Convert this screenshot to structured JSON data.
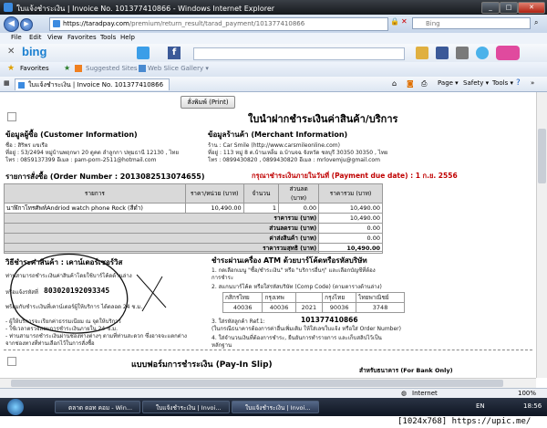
{
  "window": {
    "title": "ใบแจ้งชำระเงิน | Invoice No. 101377410866 - Windows Internet Explorer"
  },
  "address": {
    "url_prefix": "https://taradpay.com",
    "url_rest": "/premium/return_result/tarad_payment/101377410866",
    "search_placeholder": "Bing"
  },
  "menu": [
    "File",
    "Edit",
    "View",
    "Favorites",
    "Tools",
    "Help"
  ],
  "toolbar": {
    "bing": "bing"
  },
  "favorites": {
    "label": "Favorites",
    "suggested": "Suggested Sites ▾",
    "gallery": "Web Slice Gallery ▾"
  },
  "tab": {
    "label": "ใบแจ้งชำระเงิน | Invoice No. 101377410866",
    "cmds": [
      "Page ▾",
      "Safety ▾",
      "Tools ▾"
    ]
  },
  "invoice": {
    "print_button": "สั่งพิมพ์ (Print)",
    "title": "ใบนำฝากชำระเงินค่าสินค้า/บริการ",
    "customer_heading": "ข้อมูลผู้ซื้อ (Customer Information)",
    "customer_lines": [
      "ชื่อ : สิริพร แขเรือ",
      "ที่อยู่ : 53/2494 หมู่บ้านพฤกษา 20 ตูคต ลำลูกกา ปทุมธานี 12130 , ไทย",
      "โทร : 0859137399 อีเมล : pam-porn-2511@hotmail.com"
    ],
    "merchant_heading": "ข้อมูลร้านค้า (Merchant Information)",
    "merchant_lines": [
      "ร้าน : Car Smile (http://www.carsmileonline.com)",
      "ที่อยู่ : 113 หมู่ 8 ต.บ้านเหล็ม อ.บ้านจฉ  จังหวัด ชลบุรี 30350 30350 , ไทย",
      "โทร : 0899430820 , 0899430820 อีเมล : mrlovemju@gmail.com"
    ],
    "order_heading": "รายการสั่งซื้อ (Order Number : 2013082513074655)",
    "due_date": "กรุณาชำระเงินภายในวันที่ (Payment due date) : 1 ก.ย. 2556",
    "columns": [
      "รายการ",
      "ราคา/หน่วย (บาท)",
      "จำนวน",
      "ส่วนลด (บาท)",
      "ราคารวม (บาท)"
    ],
    "items": [
      {
        "name": "นาฬิกาโทรศัพท์Andriod watch phone Rock (สีดำ)",
        "price": "10,490.00",
        "qty": "1",
        "discount": "0.00",
        "total": "10,490.00"
      }
    ],
    "totals": [
      {
        "label": "ราคารวม (บาท)",
        "value": "10,490.00"
      },
      {
        "label": "ส่วนลดรวม (บาท)",
        "value": "0.00"
      },
      {
        "label": "ค่าส่งสินค้า (บาท)",
        "value": "0.00"
      },
      {
        "label": "ราคารวมสุทธิ (บาท)",
        "value": "10,490.00"
      }
    ],
    "counter_heading": "วิธีชำระค่าสินค้า : เคาน์เตอร์เซอร์วิส",
    "counter_line1": "ท่านสามารถชำระเงินค่าสินค้าโดยใช้บาร์โค้ดด้านล่าง",
    "ref_label": "หรือแจ้งรหัสที่",
    "ref_code": "803020192093345",
    "counter_line2": "พร้อมกับชำระเงินที่เคาน์เตอร์ผู้ให้บริการ ได้ตลอด 24 ช.ม.",
    "counter_notes": [
      "- ผู้ให้บริการจะเรียกค่าธรรมเนียม ณ จุดให้บริการ",
      "- ใช้เวลาตรวจสอบการชำระเงินภายใน 24 ช.ม.",
      "- ท่านสามารถชำระเงินผ่านช่องทางต่างๆ ตามที่ท่านสะดวก ซึ่งอาจจะแตกต่าง",
      "  จากช่องทางที่ท่านเลือกไว้ในการสั่งซื้อ"
    ],
    "atm_heading": "ชำระผ่านเครื่อง ATM ด้วยบาร์โค้ดหรือรหัสบริษัท",
    "atm_steps": [
      "1.  กดเลือกเมนู \"ซื้อ/ชำระเงิน\" หรือ \"บริการอื่นๆ\" และเลือกบัญชีที่ต้อง",
      "     การชำระ",
      "2.  สแกนบาร์โค้ด หรือใส่รหัสบริษัท (Comp Code) (ตามตารางด้านล่าง)"
    ],
    "bank_headers": [
      "กสิกรไทย",
      "กรุงเทพ",
      "กรุงไทย",
      "ไทยพาณิชย์"
    ],
    "bank_codes": [
      "40036",
      "40036",
      "2021",
      "90036",
      "3748"
    ],
    "ref1_label": "3.  ใส่รหัสลูกค้า Ref.1:",
    "ref1_value": "101377410866",
    "atm_step3_note": "     (ในกรณีธนาคารต้องการค่าอื่นเพิ่มเติม ให้ใส่เลขใบแจ้ง หรือใส่ Order Number)",
    "atm_step4": [
      "4.  ใส่จำนวนเงินที่ต้องการชำระ, ยืนยันการทำรายการ และเก็บสลิปไว้เป็น",
      "     หลักฐาน"
    ],
    "payin_heading": "แบบฟอร์มการชำระเงิน (Pay-In Slip)",
    "bank_only": "สำหรับธนาคาร (For Bank Only)"
  },
  "status": {
    "zone": "Internet",
    "zoom": "100%"
  },
  "taskbar": {
    "items": [
      "ตลาด ดอท คอม - Win...",
      "ใบแจ้งชำระเงิน | Invoi...",
      "ใบแจ้งชำระเงิน | Invoi..."
    ],
    "lang": "EN",
    "clock": "18:56"
  },
  "watermark": "[1024x768] https://upic.me/"
}
